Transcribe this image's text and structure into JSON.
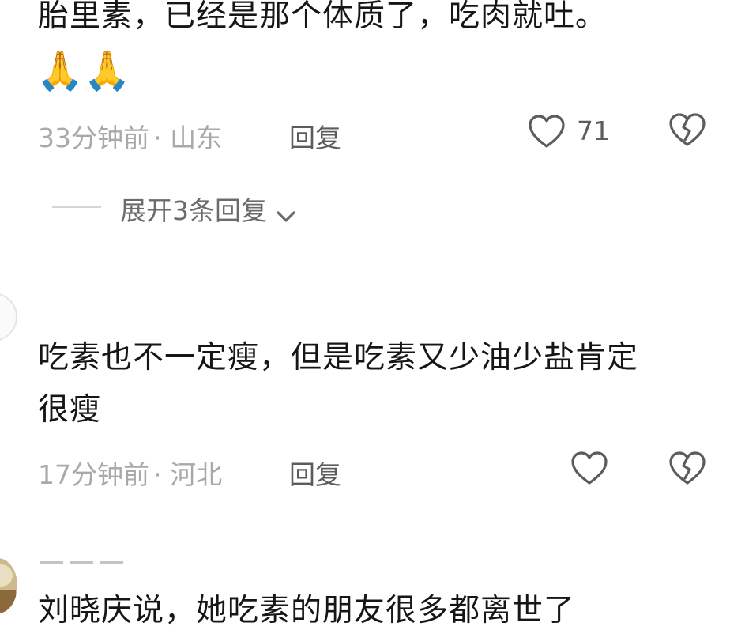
{
  "comments": [
    {
      "text": "胎里素，已经是那个体质了，吃肉就吐。",
      "emoji": "🙏🙏",
      "time": "33分钟前",
      "location": "· 山东",
      "reply_label": "回复",
      "like_count": "71",
      "expand_label": "展开3条回复"
    },
    {
      "text_line1": "吃素也不一定瘦，但是吃素又少油少盐肯定",
      "text_line2": "很瘦",
      "time": "17分钟前",
      "location": "· 河北",
      "reply_label": "回复"
    },
    {
      "text": "刘晓庆说，她吃素的朋友很多都离世了"
    }
  ],
  "icons": {
    "like": "heart-outline-icon",
    "dislike": "broken-heart-icon",
    "expand": "chevron-down-icon"
  },
  "colors": {
    "text": "#161616",
    "meta": "#a9a9a9",
    "action": "#5c5c5c"
  }
}
